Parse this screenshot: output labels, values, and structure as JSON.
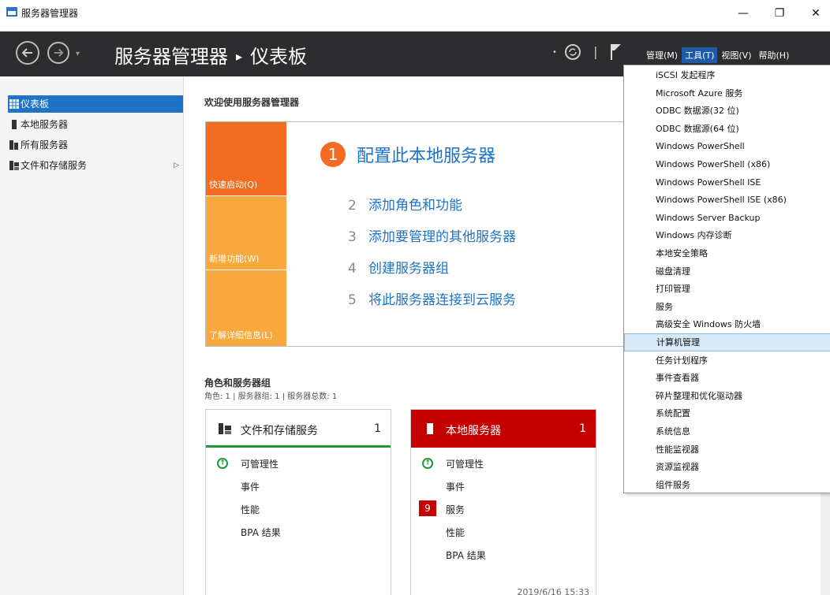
{
  "window": {
    "title": "服务器管理器",
    "min": "—",
    "restore": "❐",
    "close": "✕"
  },
  "header": {
    "breadcrumb_app": "服务器管理器",
    "breadcrumb_sep": "▸",
    "breadcrumb_page": "仪表板",
    "menus": [
      "管理(M)",
      "工具(T)",
      "视图(V)",
      "帮助(H)"
    ],
    "active_menu": "工具(T)"
  },
  "sidebar": {
    "items": [
      {
        "label": "仪表板",
        "icon": "dashboard-icon",
        "active": true
      },
      {
        "label": "本地服务器",
        "icon": "server-icon"
      },
      {
        "label": "所有服务器",
        "icon": "servers-icon"
      },
      {
        "label": "文件和存储服务",
        "icon": "storage-icon",
        "expandable": true
      }
    ]
  },
  "main": {
    "welcome": "欢迎使用服务器管理器",
    "tiles": [
      "快速启动(Q)",
      "新增功能(W)",
      "了解详细信息(L)"
    ],
    "step1": {
      "num": "1",
      "label": "配置此本地服务器"
    },
    "steps": [
      {
        "num": "2",
        "label": "添加角色和功能"
      },
      {
        "num": "3",
        "label": "添加要管理的其他服务器"
      },
      {
        "num": "4",
        "label": "创建服务器组"
      },
      {
        "num": "5",
        "label": "将此服务器连接到云服务"
      }
    ],
    "roles_title": "角色和服务器组",
    "roles_sub": "角色: 1 | 服务器组: 1 | 服务器总数: 1",
    "cards": [
      {
        "title": "文件和存储服务",
        "count": "1",
        "rows": [
          "可管理性",
          "事件",
          "性能",
          "BPA 结果"
        ]
      },
      {
        "title": "本地服务器",
        "count": "1",
        "rows": [
          "可管理性",
          "事件",
          "服务",
          "性能",
          "BPA 结果"
        ],
        "services_badge": "9",
        "timestamp": "2019/6/16 15:33"
      }
    ]
  },
  "tools_menu": {
    "items": [
      "iSCSI 发起程序",
      "Microsoft Azure 服务",
      "ODBC 数据源(32 位)",
      "ODBC 数据源(64 位)",
      "Windows PowerShell",
      "Windows PowerShell (x86)",
      "Windows PowerShell ISE",
      "Windows PowerShell ISE (x86)",
      "Windows Server Backup",
      "Windows 内存诊断",
      "本地安全策略",
      "磁盘清理",
      "打印管理",
      "服务",
      "高级安全 Windows 防火墙",
      "计算机管理",
      "任务计划程序",
      "事件查看器",
      "碎片整理和优化驱动器",
      "系统配置",
      "系统信息",
      "性能监视器",
      "资源监视器",
      "组件服务"
    ],
    "hovered_index": 15
  },
  "colors": {
    "accent": "#1e73c6",
    "orange": "#f36c21",
    "tile_light": "#f8a83c",
    "red": "#c40000",
    "green": "#1a9b3a"
  }
}
